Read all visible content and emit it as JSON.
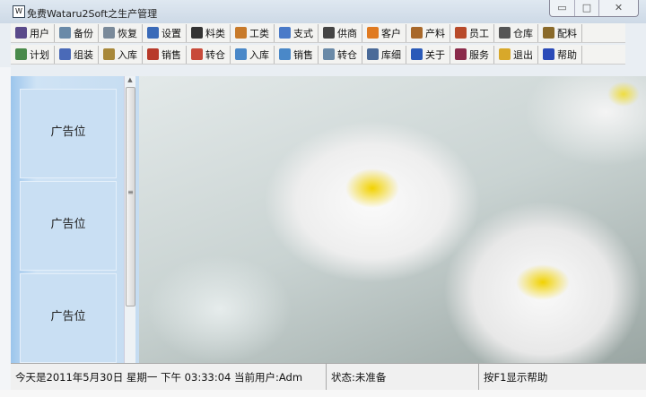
{
  "window": {
    "title": "免费Wataru2Soft之生产管理",
    "minimize": "▭",
    "maximize": "□",
    "close": "✕"
  },
  "toolbar1": [
    {
      "label": "用户",
      "icon": "users-icon",
      "color": "#5a4a8a"
    },
    {
      "label": "备份",
      "icon": "backup-icon",
      "color": "#6a8aa8"
    },
    {
      "label": "恢复",
      "icon": "restore-icon",
      "color": "#7a8a9a"
    },
    {
      "label": "设置",
      "icon": "settings-icon",
      "color": "#3a6ab8"
    },
    {
      "label": "料类",
      "icon": "material-type-icon",
      "color": "#333333"
    },
    {
      "label": "工类",
      "icon": "work-type-icon",
      "color": "#c87a2a"
    },
    {
      "label": "支式",
      "icon": "payment-icon",
      "color": "#4a7ac8"
    },
    {
      "label": "供商",
      "icon": "supplier-icon",
      "color": "#444444"
    },
    {
      "label": "客户",
      "icon": "customer-icon",
      "color": "#e07a20"
    },
    {
      "label": "产料",
      "icon": "product-icon",
      "color": "#a8682a"
    },
    {
      "label": "员工",
      "icon": "staff-icon",
      "color": "#b84a2a"
    },
    {
      "label": "仓库",
      "icon": "warehouse-icon",
      "color": "#555555"
    },
    {
      "label": "配料",
      "icon": "ingredients-icon",
      "color": "#8a6a2a"
    }
  ],
  "toolbar2": [
    {
      "label": "计划",
      "icon": "plan-icon",
      "color": "#4a8a4a"
    },
    {
      "label": "组装",
      "icon": "assemble-icon",
      "color": "#4a6ab8"
    },
    {
      "label": "入库",
      "icon": "stock-in-icon",
      "color": "#a8883a"
    },
    {
      "label": "销售",
      "icon": "sales-icon",
      "color": "#b83a2a"
    },
    {
      "label": "转仓",
      "icon": "transfer-icon",
      "color": "#c84a3a"
    },
    {
      "label": "入库",
      "icon": "search-stock-in-icon",
      "color": "#4a88c8"
    },
    {
      "label": "销售",
      "icon": "search-sales-icon",
      "color": "#4a88c8"
    },
    {
      "label": "转仓",
      "icon": "search-transfer-icon",
      "color": "#6a8aa8"
    },
    {
      "label": "库细",
      "icon": "stock-detail-icon",
      "color": "#4a6a98"
    },
    {
      "label": "关于",
      "icon": "about-icon",
      "color": "#2a5ab8"
    },
    {
      "label": "服务",
      "icon": "service-icon",
      "color": "#8a2a4a"
    },
    {
      "label": "退出",
      "icon": "exit-icon",
      "color": "#d8a82a"
    },
    {
      "label": "帮助",
      "icon": "help-icon",
      "color": "#2a4ab8"
    }
  ],
  "ads": [
    "广告位",
    "广告位",
    "广告位"
  ],
  "status": {
    "datetime": "今天是2011年5月30日 星期一 下午 03:33:04 当前用户:Adm",
    "state": "状态:未准备",
    "help": "按F1显示帮助"
  }
}
